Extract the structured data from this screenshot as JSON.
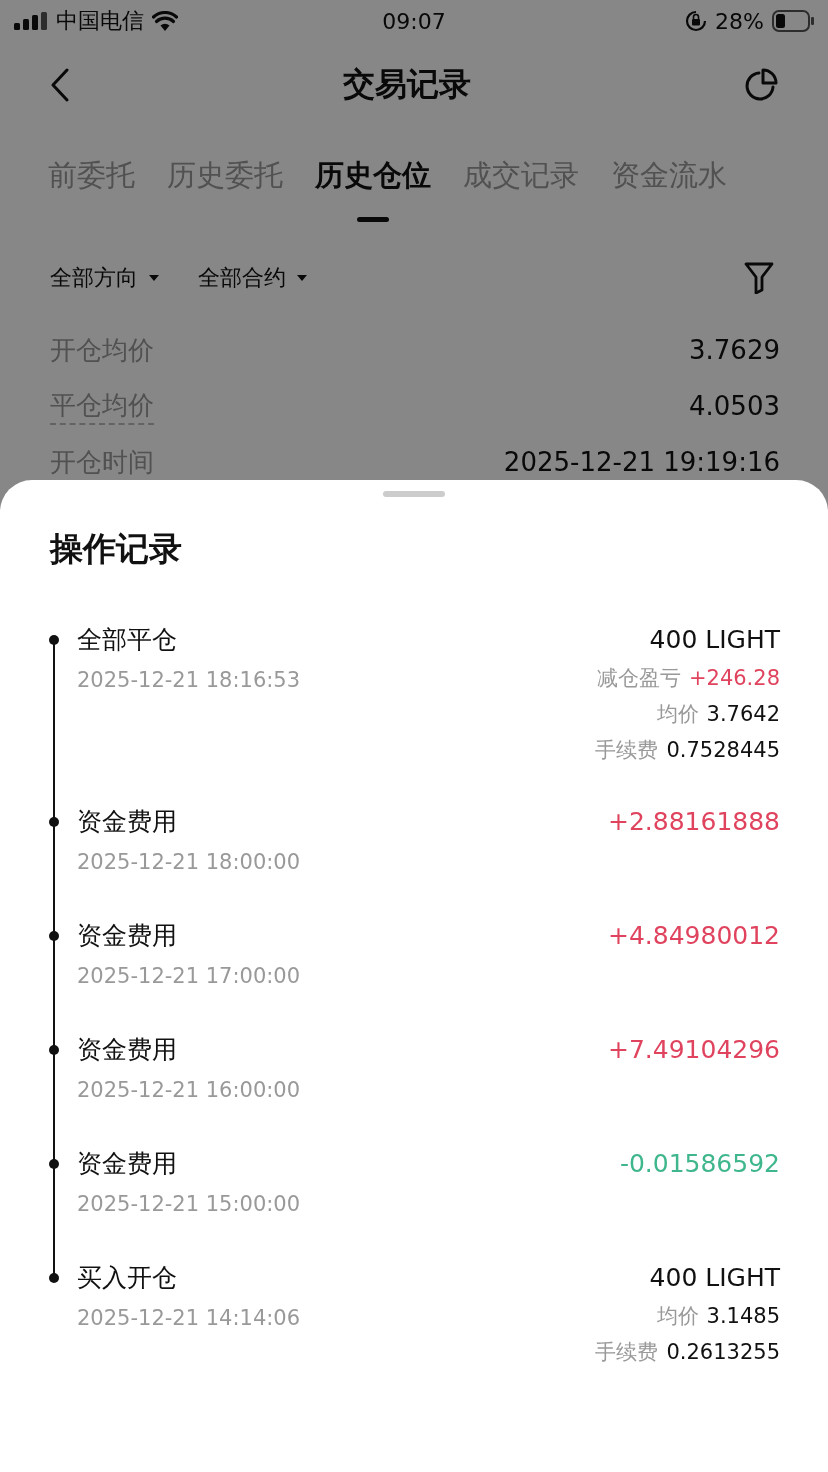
{
  "status_bar": {
    "carrier": "中国电信",
    "time": "09:07",
    "battery": "28%"
  },
  "header": {
    "title": "交易记录"
  },
  "tabs": [
    {
      "label": "前委托",
      "selected": false
    },
    {
      "label": "历史委托",
      "selected": false
    },
    {
      "label": "历史仓位",
      "selected": true
    },
    {
      "label": "成交记录",
      "selected": false
    },
    {
      "label": "资金流水",
      "selected": false
    }
  ],
  "filters": [
    {
      "label": "全部方向"
    },
    {
      "label": "全部合约"
    }
  ],
  "summary": [
    {
      "label": "开仓均价",
      "value": "3.7629",
      "underlined": false
    },
    {
      "label": "平仓均价",
      "value": "4.0503",
      "underlined": true
    },
    {
      "label": "开仓时间",
      "value": "2025-12-21 19:19:16",
      "underlined": false
    }
  ],
  "sheet": {
    "title": "操作记录",
    "records": [
      {
        "title": "全部平仓",
        "time": "2025-12-21 18:16:53",
        "amount": "400 LIGHT",
        "color": "#111111",
        "details": [
          {
            "label": "减仓盈亏",
            "value": "+246.28",
            "color": "#e0435e"
          },
          {
            "label": "均价",
            "value": "3.7642",
            "color": "#111111"
          },
          {
            "label": "手续费",
            "value": "0.7528445",
            "color": "#111111"
          }
        ]
      },
      {
        "title": "资金费用",
        "time": "2025-12-21 18:00:00",
        "amount": "+2.88161888",
        "color": "#e0435e"
      },
      {
        "title": "资金费用",
        "time": "2025-12-21 17:00:00",
        "amount": "+4.84980012",
        "color": "#e0435e"
      },
      {
        "title": "资金费用",
        "time": "2025-12-21 16:00:00",
        "amount": "+7.49104296",
        "color": "#e0435e"
      },
      {
        "title": "资金费用",
        "time": "2025-12-21 15:00:00",
        "amount": "-0.01586592",
        "color": "#3fb68b"
      },
      {
        "title": "买入开仓",
        "time": "2025-12-21 14:14:06",
        "amount": "400 LIGHT",
        "color": "#111111",
        "details": [
          {
            "label": "均价",
            "value": "3.1485",
            "color": "#111111"
          },
          {
            "label": "手续费",
            "value": "0.2613255",
            "color": "#111111"
          }
        ]
      }
    ]
  }
}
